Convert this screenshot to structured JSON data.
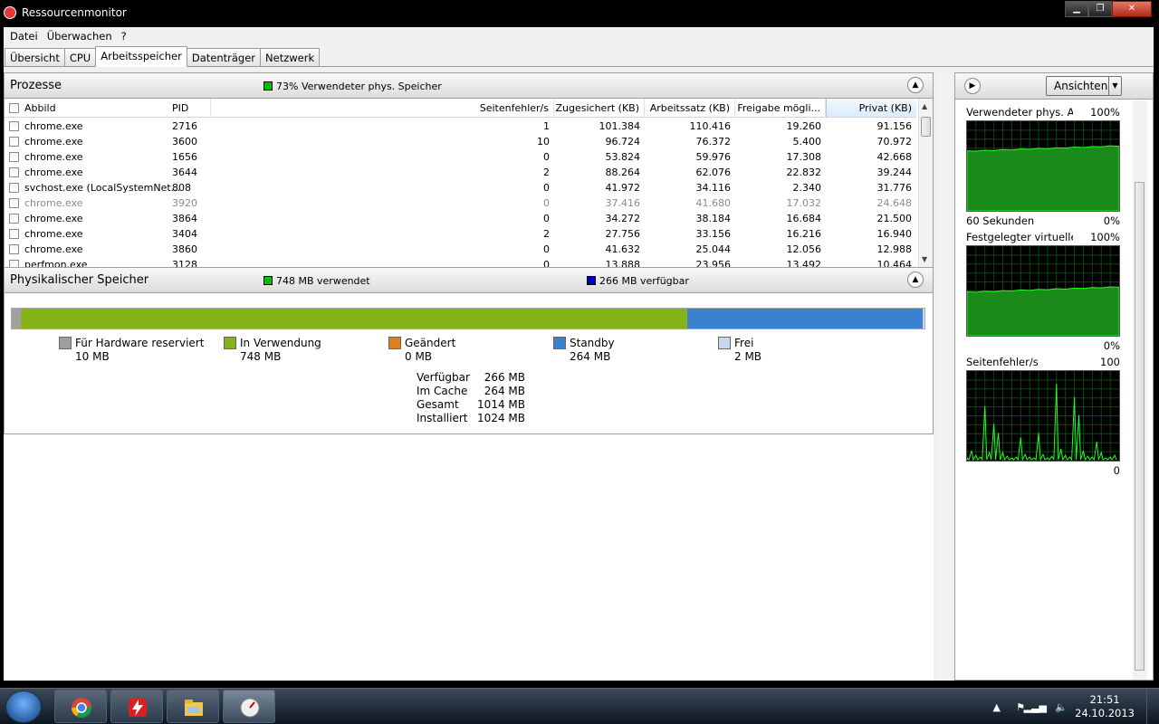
{
  "window": {
    "title": "Ressourcenmonitor",
    "minimize": "▁",
    "maximize": "❐",
    "close": "✕"
  },
  "menu": [
    "Datei",
    "Überwachen",
    "?"
  ],
  "tabs": [
    "Übersicht",
    "CPU",
    "Arbeitsspeicher",
    "Datenträger",
    "Netzwerk"
  ],
  "active_tab": "Arbeitsspeicher",
  "processes": {
    "title": "Prozesse",
    "summary": "73% Verwendeter phys. Speicher",
    "summary_color": "#00c000",
    "columns": [
      "Abbild",
      "PID",
      "Seitenfehler/s",
      "Zugesichert (KB)",
      "Arbeitssatz (KB)",
      "Freigabe mögli...",
      "Privat (KB)"
    ],
    "rows": [
      {
        "name": "chrome.exe",
        "pid": "2716",
        "faults": "1",
        "commit": "101.384",
        "ws": "110.416",
        "share": "19.260",
        "priv": "91.156",
        "gray": false
      },
      {
        "name": "chrome.exe",
        "pid": "3600",
        "faults": "10",
        "commit": "96.724",
        "ws": "76.372",
        "share": "5.400",
        "priv": "70.972",
        "gray": false
      },
      {
        "name": "chrome.exe",
        "pid": "1656",
        "faults": "0",
        "commit": "53.824",
        "ws": "59.976",
        "share": "17.308",
        "priv": "42.668",
        "gray": false
      },
      {
        "name": "chrome.exe",
        "pid": "3644",
        "faults": "2",
        "commit": "88.264",
        "ws": "62.076",
        "share": "22.832",
        "priv": "39.244",
        "gray": false
      },
      {
        "name": "svchost.exe (LocalSystemNet...",
        "pid": "808",
        "faults": "0",
        "commit": "41.972",
        "ws": "34.116",
        "share": "2.340",
        "priv": "31.776",
        "gray": false
      },
      {
        "name": "chrome.exe",
        "pid": "3920",
        "faults": "0",
        "commit": "37.416",
        "ws": "41.680",
        "share": "17.032",
        "priv": "24.648",
        "gray": true
      },
      {
        "name": "chrome.exe",
        "pid": "3864",
        "faults": "0",
        "commit": "34.272",
        "ws": "38.184",
        "share": "16.684",
        "priv": "21.500",
        "gray": false
      },
      {
        "name": "chrome.exe",
        "pid": "3404",
        "faults": "2",
        "commit": "27.756",
        "ws": "33.156",
        "share": "16.216",
        "priv": "16.940",
        "gray": false
      },
      {
        "name": "chrome.exe",
        "pid": "3860",
        "faults": "0",
        "commit": "41.632",
        "ws": "25.044",
        "share": "12.056",
        "priv": "12.988",
        "gray": false
      },
      {
        "name": "perfmon.exe",
        "pid": "3128",
        "faults": "0",
        "commit": "13.888",
        "ws": "23.956",
        "share": "13.492",
        "priv": "10.464",
        "gray": false
      }
    ]
  },
  "physical": {
    "title": "Physikalischer Speicher",
    "used_label": "748 MB verwendet",
    "used_color": "#00c000",
    "avail_label": "266 MB verfügbar",
    "avail_color": "#0000c0",
    "bar": [
      {
        "name": "hardware",
        "mb": 10,
        "color": "#a0a0a0"
      },
      {
        "name": "in-use",
        "mb": 748,
        "color": "#86b31a"
      },
      {
        "name": "modified",
        "mb": 0,
        "color": "#e0801a"
      },
      {
        "name": "standby",
        "mb": 264,
        "color": "#3c80d0"
      },
      {
        "name": "free",
        "mb": 2,
        "color": "#c8d8f0"
      }
    ],
    "legend": [
      {
        "label": "Für Hardware reserviert",
        "value": "10 MB",
        "color": "#a0a0a0"
      },
      {
        "label": "In Verwendung",
        "value": "748 MB",
        "color": "#86b31a"
      },
      {
        "label": "Geändert",
        "value": "0 MB",
        "color": "#e0801a"
      },
      {
        "label": "Standby",
        "value": "264 MB",
        "color": "#3c80d0"
      },
      {
        "label": "Frei",
        "value": "2 MB",
        "color": "#c8d8f0"
      }
    ],
    "stats": [
      {
        "k": "Verfügbar",
        "v": "266 MB"
      },
      {
        "k": "Im Cache",
        "v": "264 MB"
      },
      {
        "k": "Gesamt",
        "v": "1014 MB"
      },
      {
        "k": "Installiert",
        "v": "1024 MB"
      }
    ]
  },
  "right": {
    "views_label": "Ansichten",
    "graphs": [
      {
        "title": "Verwendeter phys. Arbe...",
        "max": "100%",
        "foot_left": "60 Sekunden",
        "foot_right": "0%",
        "kind": "area",
        "level": 0.73
      },
      {
        "title": "Festgelegter virtueller S...",
        "max": "100%",
        "foot_left": "",
        "foot_right": "0%",
        "kind": "area",
        "level": 0.55
      },
      {
        "title": "Seitenfehler/s",
        "max": "100",
        "foot_left": "",
        "foot_right": "0",
        "kind": "spikes",
        "level": 0.1
      }
    ]
  },
  "taskbar": {
    "time": "21:51",
    "date": "24.10.2013"
  }
}
